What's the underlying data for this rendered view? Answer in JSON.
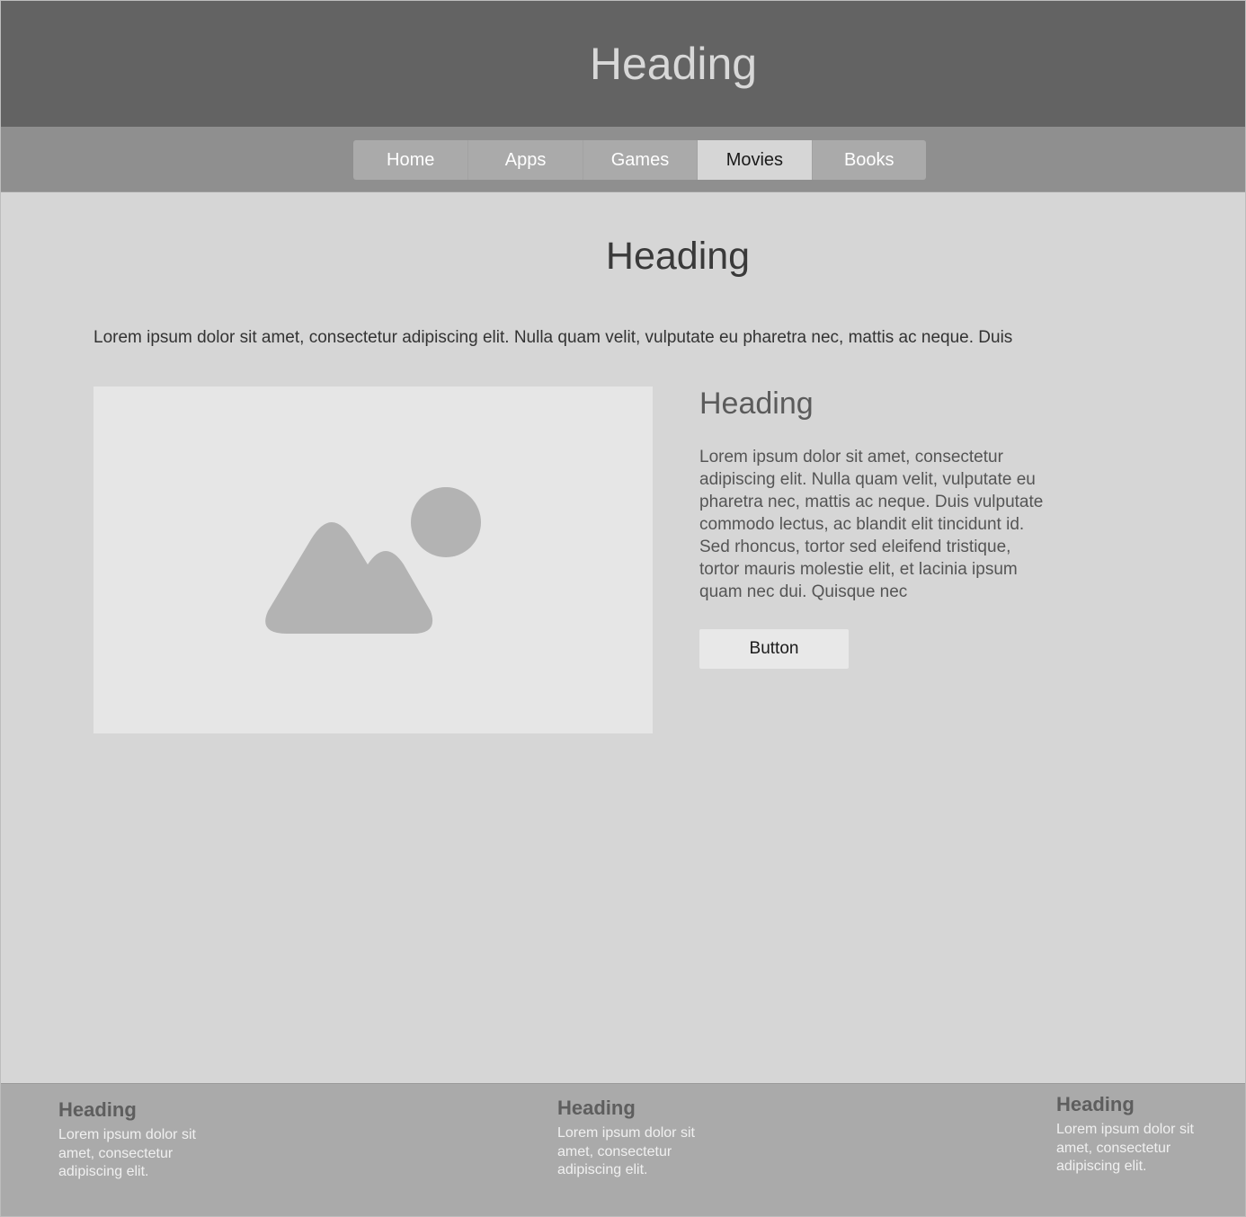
{
  "header": {
    "title": "Heading"
  },
  "nav": {
    "tabs": [
      {
        "label": "Home"
      },
      {
        "label": "Apps"
      },
      {
        "label": "Games"
      },
      {
        "label": "Movies",
        "active": true
      },
      {
        "label": "Books"
      }
    ]
  },
  "main": {
    "heading": "Heading",
    "intro": "Lorem ipsum dolor sit amet, consectetur adipiscing elit. Nulla quam velit, vulputate eu pharetra nec, mattis ac neque. Duis",
    "image": {
      "icon": "image-placeholder-icon"
    },
    "card": {
      "heading": "Heading",
      "text": "Lorem ipsum dolor sit amet, consectetur adipiscing elit. Nulla quam velit, vulputate eu pharetra nec, mattis ac neque. Duis vulputate commodo lectus, ac blandit elit tincidunt id. Sed rhoncus, tortor sed eleifend tristique, tortor mauris molestie elit, et lacinia ipsum quam nec dui. Quisque nec",
      "button_label": "Button"
    }
  },
  "footer": {
    "columns": [
      {
        "heading": "Heading",
        "text": "Lorem ipsum dolor sit amet, consectetur adipiscing elit."
      },
      {
        "heading": "Heading",
        "text": "Lorem ipsum dolor sit amet, consectetur adipiscing elit."
      },
      {
        "heading": "Heading",
        "text": "Lorem ipsum dolor sit amet, consectetur adipiscing elit."
      }
    ]
  },
  "colors": {
    "header_bg": "#636363",
    "nav_bg": "#8f8f8f",
    "page_bg": "#d6d6d6",
    "footer_bg": "#aaaaaa"
  }
}
